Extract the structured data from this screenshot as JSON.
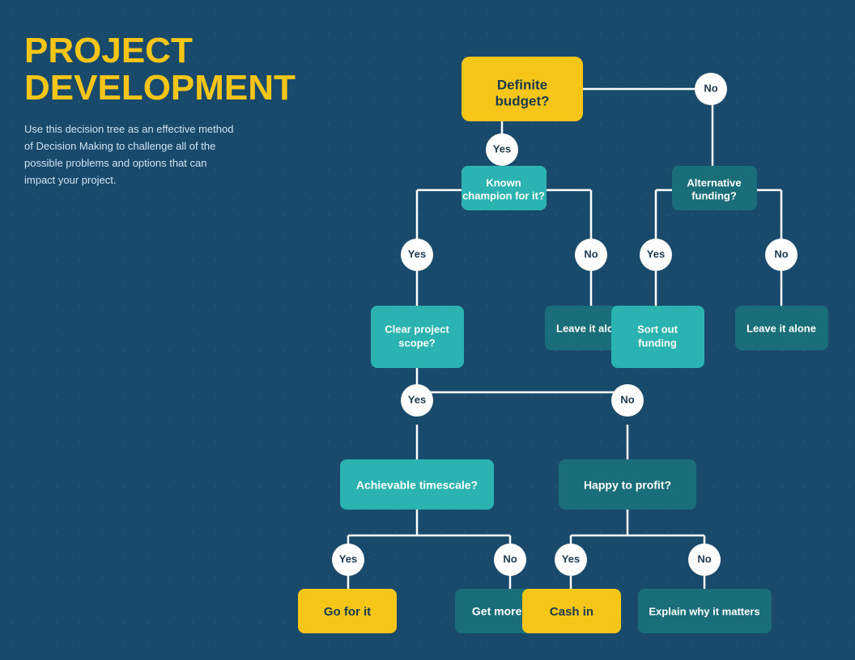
{
  "title": "PROJECT\nDEVELOPMENT",
  "subtitle": "Use this decision tree as an effective method of Decision Making to challenge all of the possible problems and options that can impact your project.",
  "nodes": {
    "definite_budget": "Definite budget?",
    "known_champion": "Known champion for it?",
    "alternative_funding": "Alternative funding?",
    "clear_project_scope": "Clear project scope?",
    "leave_it_alone_1": "Leave it alone",
    "sort_out_funding": "Sort out funding",
    "leave_it_alone_2": "Leave it alone",
    "achievable_timescale": "Achievable timescale?",
    "happy_to_profit": "Happy to profit?",
    "go_for_it": "Go for it",
    "get_more_time": "Get more time",
    "cash_in": "Cash in",
    "explain_why": "Explain why it matters"
  },
  "labels": {
    "yes": "Yes",
    "no": "No"
  },
  "colors": {
    "yellow": "#f5c518",
    "teal": "#2ab3b1",
    "dark_teal": "#1a6e7a",
    "bg": "#1a4a6b",
    "white": "#ffffff",
    "text_dark": "#1a3a50"
  }
}
